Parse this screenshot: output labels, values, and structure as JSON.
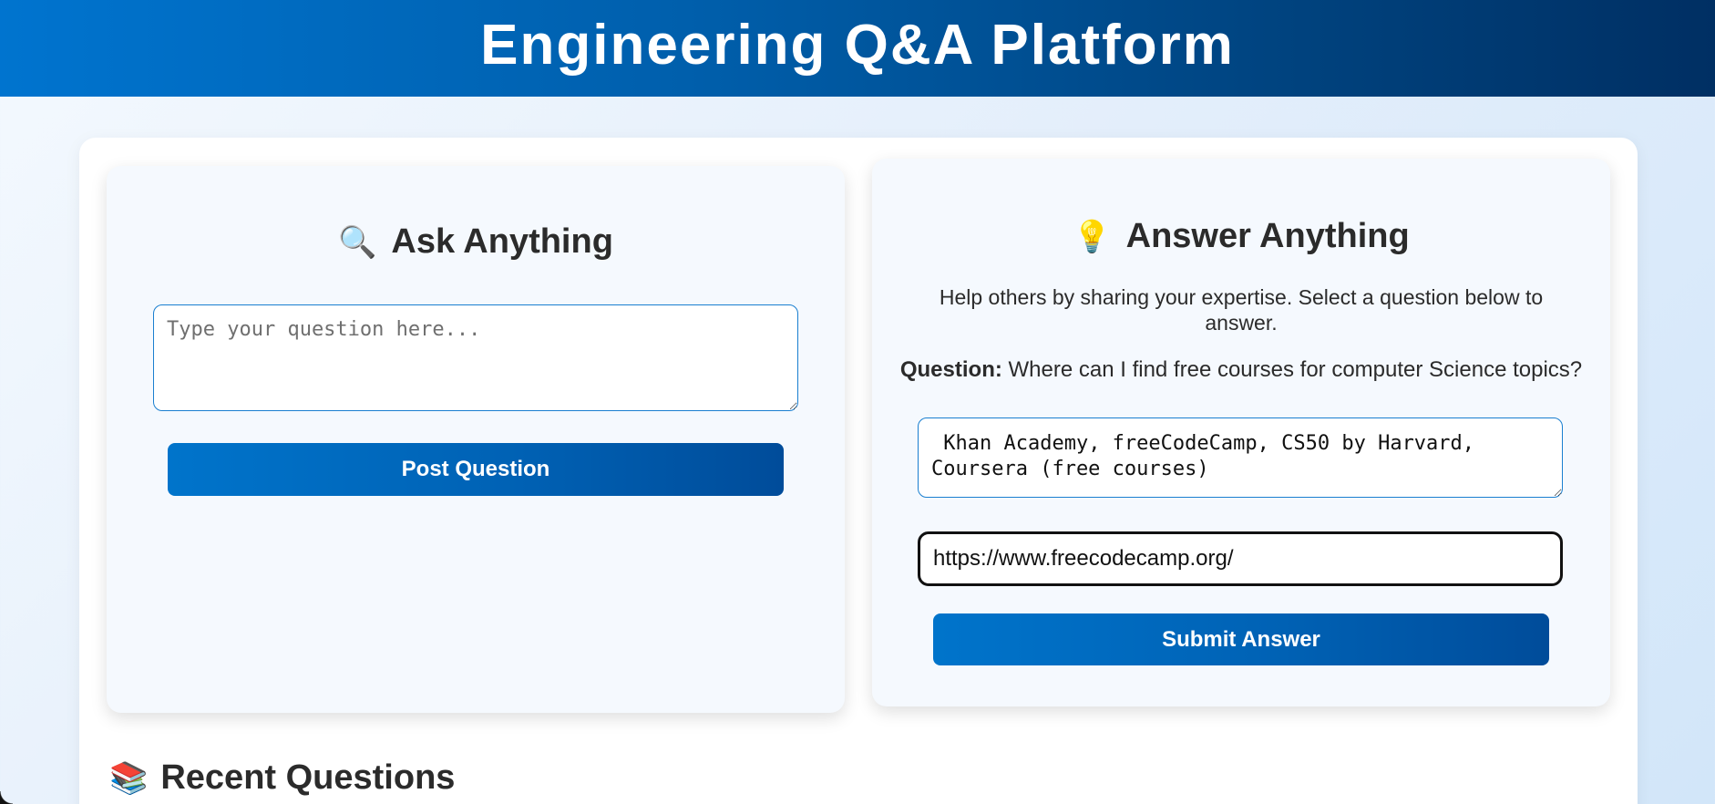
{
  "header": {
    "title": "Engineering Q&A Platform"
  },
  "ask": {
    "icon": "magnifier-icon",
    "emoji": "🔍",
    "title": "Ask Anything",
    "question_placeholder": "Type your question here...",
    "question_value": "",
    "post_label": "Post Question"
  },
  "answer": {
    "icon": "lightbulb-icon",
    "emoji": "💡",
    "title": "Answer Anything",
    "help_text": "Help others by sharing your expertise. Select a question below to answer.",
    "question_label": "Question:",
    "question_text": "Where can I find free courses for computer Science topics?",
    "answer_value": " Khan Academy, freeCodeCamp, CS50 by Harvard, Coursera (free courses)",
    "link_value": "https://www.freecodecamp.org/",
    "submit_label": "Submit Answer"
  },
  "recent": {
    "icon": "books-icon",
    "emoji": "📚",
    "title": "Recent Questions"
  },
  "colors": {
    "header_start": "#0074cf",
    "header_end": "#002f63",
    "button_start": "#0074cb",
    "button_end": "#004c9a",
    "input_border": "#1a7fd0"
  }
}
